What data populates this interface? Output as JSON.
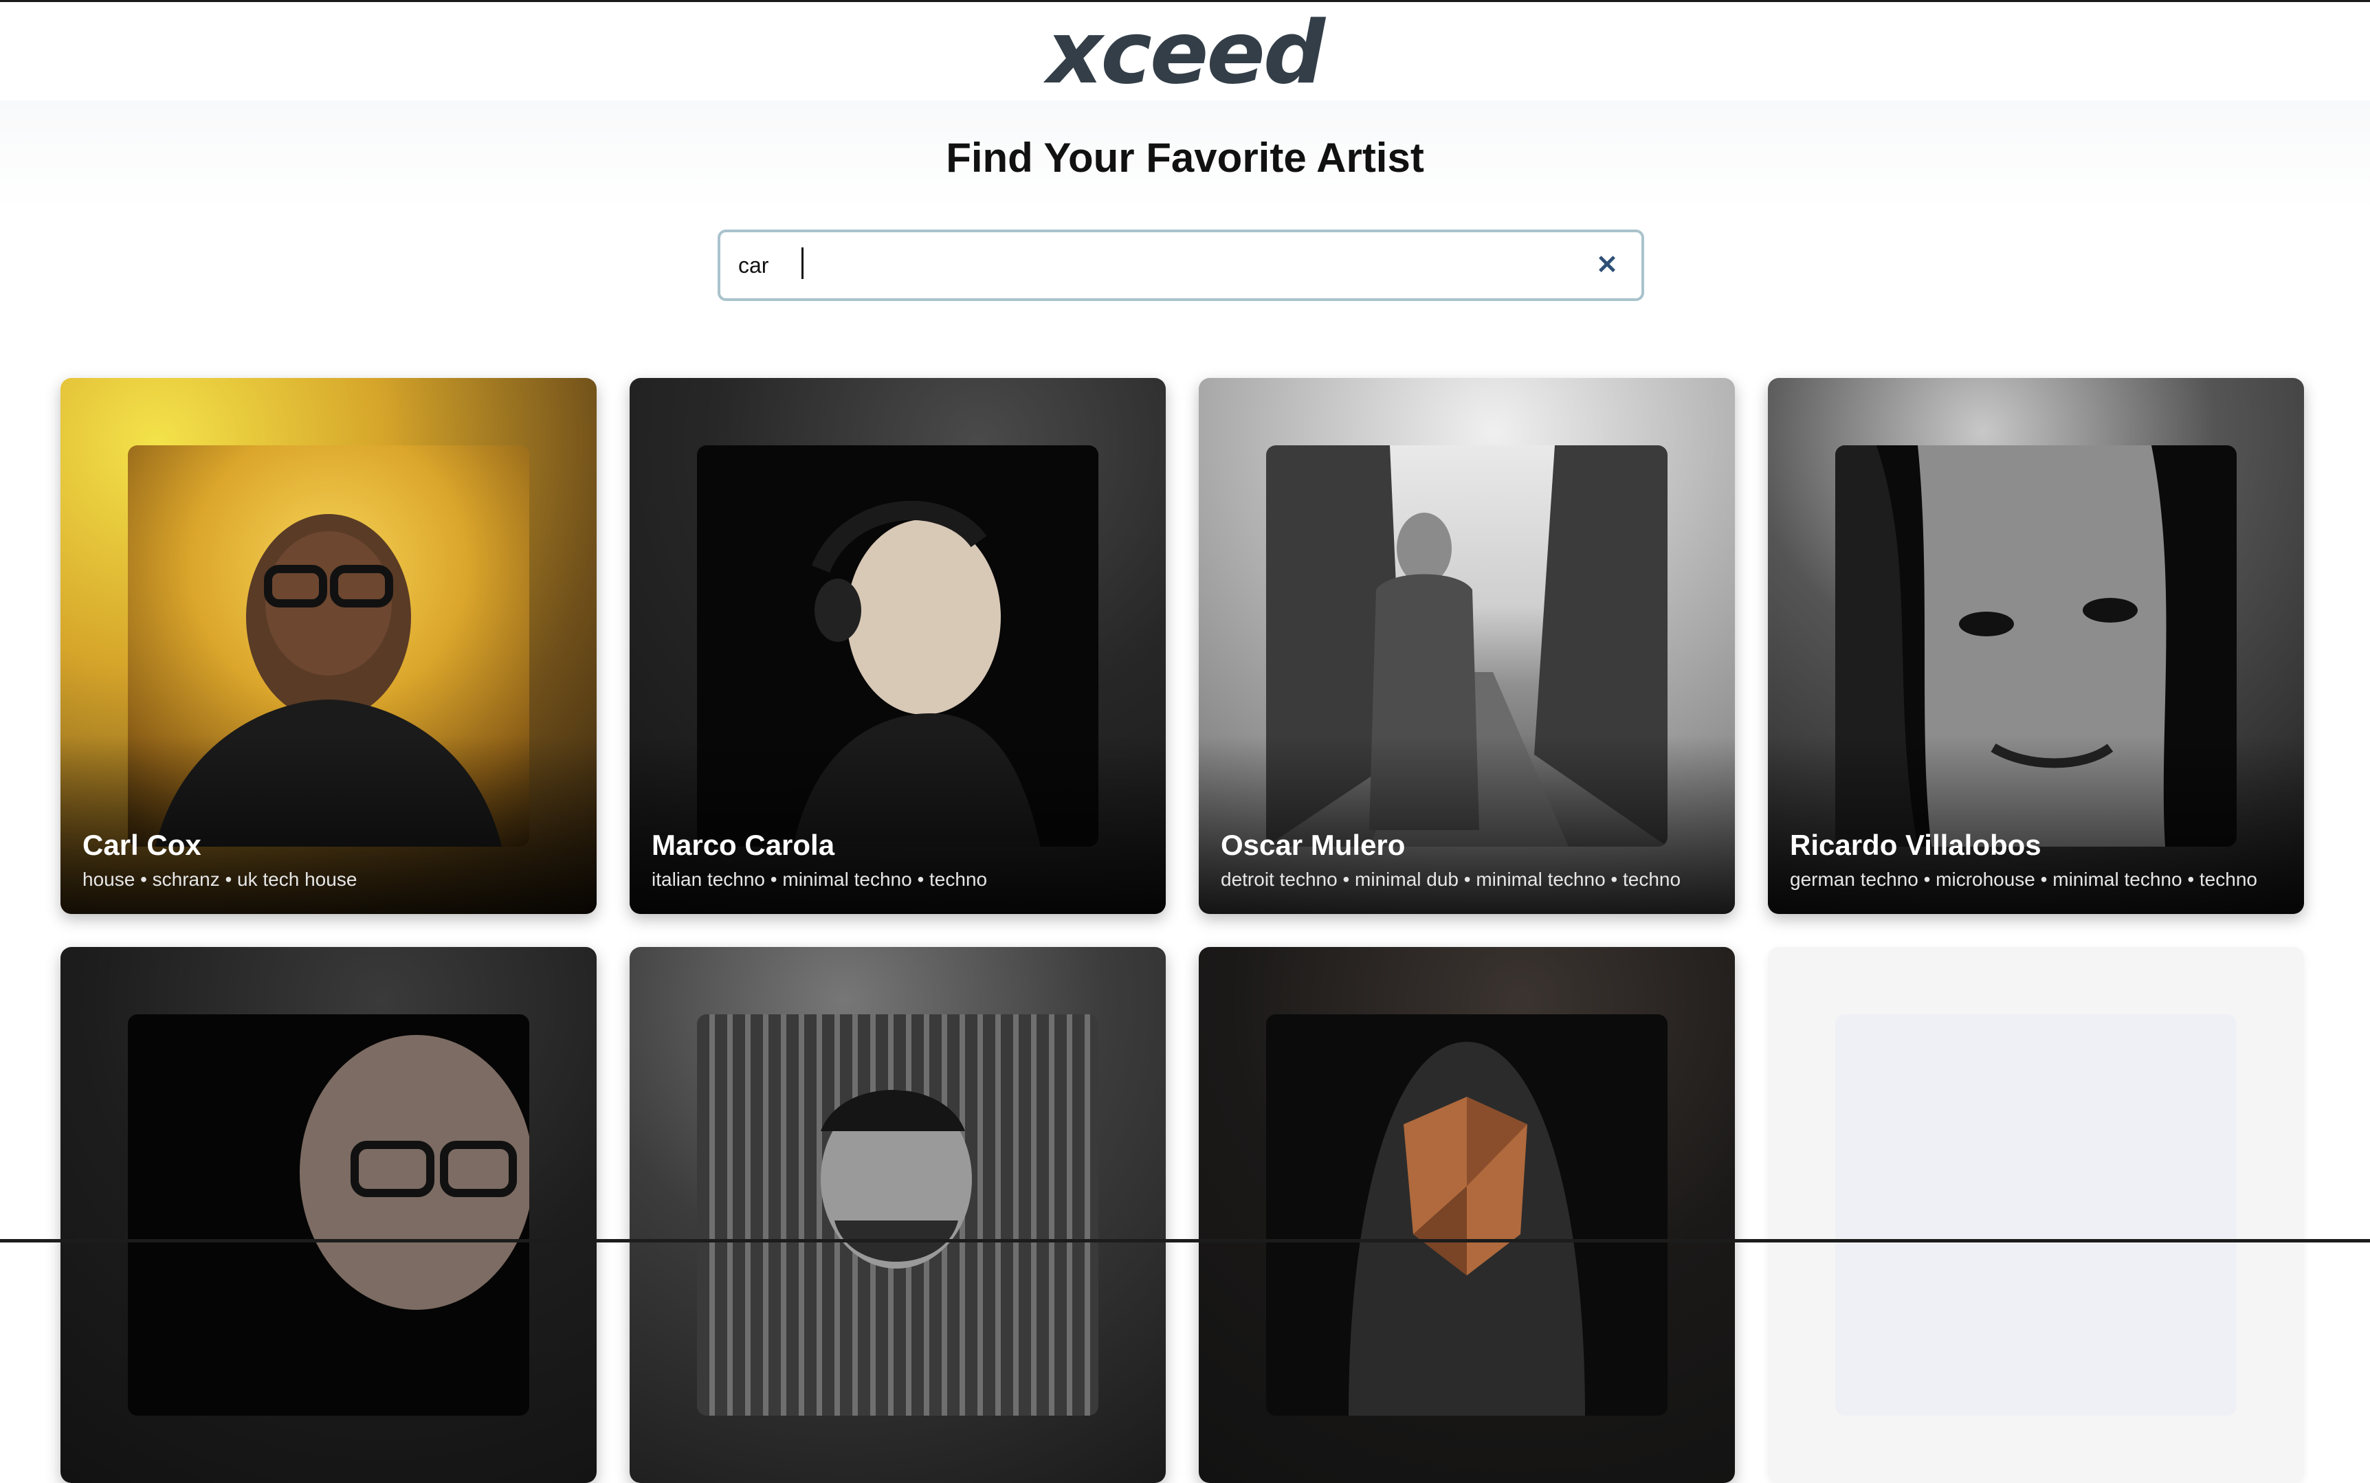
{
  "header": {
    "logo_text": "xceed"
  },
  "page": {
    "title": "Find Your Favorite Artist"
  },
  "search": {
    "value": "car",
    "clear_icon": "close-icon"
  },
  "artists": [
    {
      "name": "Carl Cox",
      "genres": "house • schranz • uk tech house"
    },
    {
      "name": "Marco Carola",
      "genres": "italian techno • minimal techno • techno"
    },
    {
      "name": "Oscar Mulero",
      "genres": "detroit techno • minimal dub • minimal techno • techno"
    },
    {
      "name": "Ricardo Villalobos",
      "genres": "german techno • microhouse • minimal techno • techno"
    }
  ],
  "colors": {
    "logo": "#333e48",
    "search_border": "#a9c3cc",
    "clear_icon": "#2f4f77"
  }
}
